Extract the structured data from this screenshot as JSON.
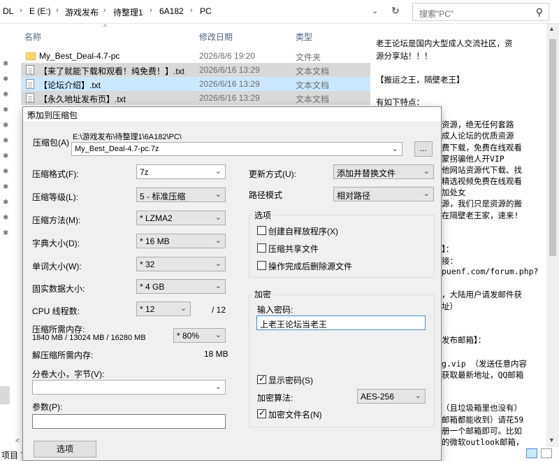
{
  "explorer": {
    "breadcrumb": [
      "DL",
      "E (E:)",
      "游戏发布",
      "待整理1",
      "6A182",
      "PC"
    ],
    "search_placeholder": "搜索\"PC\"",
    "columns": {
      "name": "名称",
      "date": "修改日期",
      "type": "类型"
    },
    "files": [
      {
        "name": "My_Best_Deal-4.7-pc",
        "date": "2026/8/6 19:20",
        "type": "文件夹",
        "icon": "folder-icon",
        "state": "normal"
      },
      {
        "name": "【来了就能下载和观看！纯免费！】.txt",
        "date": "2026/6/16 13:29",
        "type": "文本文档",
        "icon": "text-file-icon",
        "state": "highlight"
      },
      {
        "name": "【论坛介绍】.txt",
        "date": "2026/6/16 13:29",
        "type": "文本文档",
        "icon": "text-file-icon",
        "state": "selected"
      },
      {
        "name": "【永久地址发布页】.txt",
        "date": "2026/6/16 13:29",
        "type": "文本文档",
        "icon": "text-file-icon",
        "state": "highlight"
      }
    ],
    "status_text": "项目 7"
  },
  "preview": {
    "lines": [
      "老王论坛是国内大型成人交流社区，资",
      "源分享站！！！",
      "",
      "【搬运之王，隔壁老王】",
      "",
      "有如下特点：",
      "资源，绝无任何套路",
      "成人论坛的优质资源",
      "费下载，免费在线观看",
      "蒙拐骗他人开VIP",
      "他网站资源代下载、找",
      "精选视频免费在线观看",
      "加处女",
      "源，我们只是资源的搬",
      "在隔壁老王家，速来!",
      "",
      "】：",
      "接：",
      "puenf.com/forum.php?",
      "",
      "，大陆用户请发邮件获",
      "址）",
      "",
      "",
      "发布邮箱】：",
      "",
      "g.vip （发送任意内容",
      "获取最新地址，QQ邮箱",
      "",
      "",
      "（且垃圾箱里也没有）",
      "邮箱都能收到）请花59",
      "册一个邮箱即可。比如",
      "的微软outlook邮箱，"
    ]
  },
  "dialog": {
    "title": "添加到压缩包",
    "archive_label": "压缩包(A)",
    "archive_path": "E:\\游戏发布\\待整理1\\6A182\\PC\\",
    "archive_name": "My_Best_Deal-4.7-pc.7z",
    "browse_label": "...",
    "format_label": "压缩格式(F):",
    "format_value": "7z",
    "level_label": "压缩等级(L):",
    "level_value": "5 - 标准压缩",
    "method_label": "压缩方法(M):",
    "method_value": "* LZMA2",
    "dict_label": "字典大小(D):",
    "dict_value": "* 16 MB",
    "word_label": "单词大小(W):",
    "word_value": "* 32",
    "solid_label": "固实数据大小:",
    "solid_value": "* 4 GB",
    "cpu_label": "CPU 线程数:",
    "cpu_value": "* 12",
    "cpu_total": "/ 12",
    "mem_label": "压缩所需内存:",
    "mem_value": "1840 MB / 13024 MB / 16280 MB",
    "mem_pct": "* 80%",
    "decomp_label": "解压缩所需内存:",
    "decomp_value": "18 MB",
    "volume_label": "分卷大小，字节(V):",
    "params_label": "参数(P):",
    "options_button": "选项",
    "update_label": "更新方式(U):",
    "update_value": "添加并替换文件",
    "pathmode_label": "路径模式",
    "pathmode_value": "相对路径",
    "options_group": "选项",
    "opt_sfx": "创建自释放程序(X)",
    "opt_shared": "压缩共享文件",
    "opt_delete": "操作完成后删除源文件",
    "encrypt_group": "加密",
    "password_label": "输入密码:",
    "password_value": "上老王论坛当老王",
    "show_password": "显示密码(S)",
    "enc_method_label": "加密算法:",
    "enc_method_value": "AES-256",
    "encrypt_names": "加密文件名(N)"
  }
}
